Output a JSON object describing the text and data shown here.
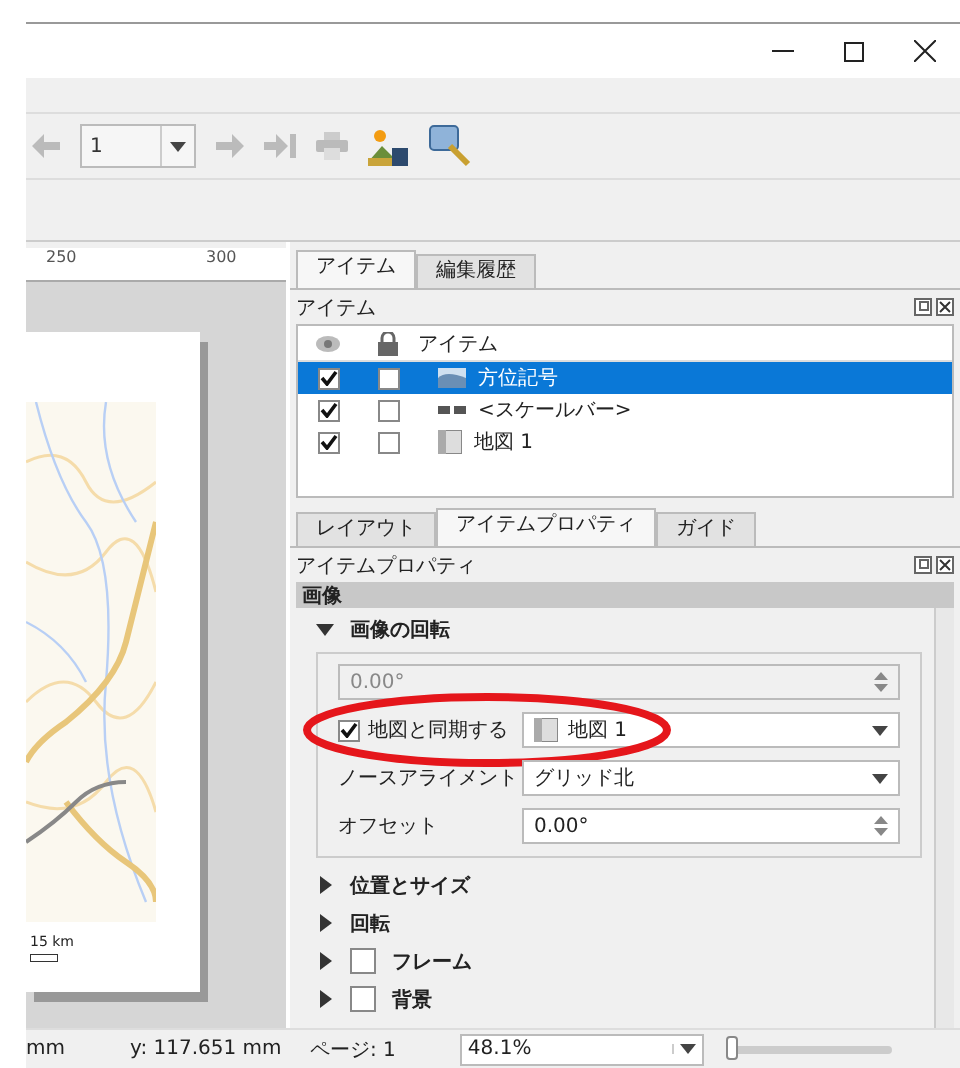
{
  "toolbar": {
    "page_field": {
      "value": "1"
    }
  },
  "ruler": {
    "labels": [
      "250",
      "300"
    ]
  },
  "canvas": {
    "scale_bar_label": "15 km"
  },
  "items_panel": {
    "tabs": [
      {
        "label": "アイテム",
        "selected": true
      },
      {
        "label": "編集履歴",
        "selected": false
      }
    ],
    "title": "アイテム",
    "column_header": "アイテム",
    "rows": [
      {
        "name": "方位記号",
        "kind": "picture",
        "visible": true,
        "locked": false,
        "selected": true
      },
      {
        "name": "<スケールバー>",
        "kind": "scalebar",
        "visible": true,
        "locked": false,
        "selected": false
      },
      {
        "name": "地図 1",
        "kind": "map",
        "visible": true,
        "locked": false,
        "selected": false
      }
    ]
  },
  "properties_panel": {
    "tabs": [
      {
        "label": "レイアウト",
        "selected": false
      },
      {
        "label": "アイテムプロパティ",
        "selected": true
      },
      {
        "label": "ガイド",
        "selected": false
      }
    ],
    "title": "アイテムプロパティ",
    "section": "画像",
    "rotation": {
      "title": "画像の回転",
      "expanded": true,
      "angle": {
        "value": "0.00°",
        "disabled": true
      },
      "sync": {
        "label": "地図と同期する",
        "checked": true,
        "map": "地図 1"
      },
      "alignment": {
        "label": "ノースアライメント",
        "value": "グリッド北"
      },
      "offset": {
        "label": "オフセット",
        "value": "0.00°"
      }
    },
    "groups": [
      {
        "title": "位置とサイズ",
        "kind": "plain",
        "expanded": false
      },
      {
        "title": "回転",
        "kind": "plain",
        "expanded": false
      },
      {
        "title": "フレーム",
        "kind": "checkable",
        "checked": false,
        "expanded": false
      },
      {
        "title": "背景",
        "kind": "checkable",
        "checked": false,
        "expanded": false
      }
    ]
  },
  "status_bar": {
    "x_fragment": "mm",
    "y": "y: 117.651 mm",
    "page": "ページ: 1",
    "zoom": "48.1%",
    "zoom_slider": {
      "level": 0.04
    }
  }
}
